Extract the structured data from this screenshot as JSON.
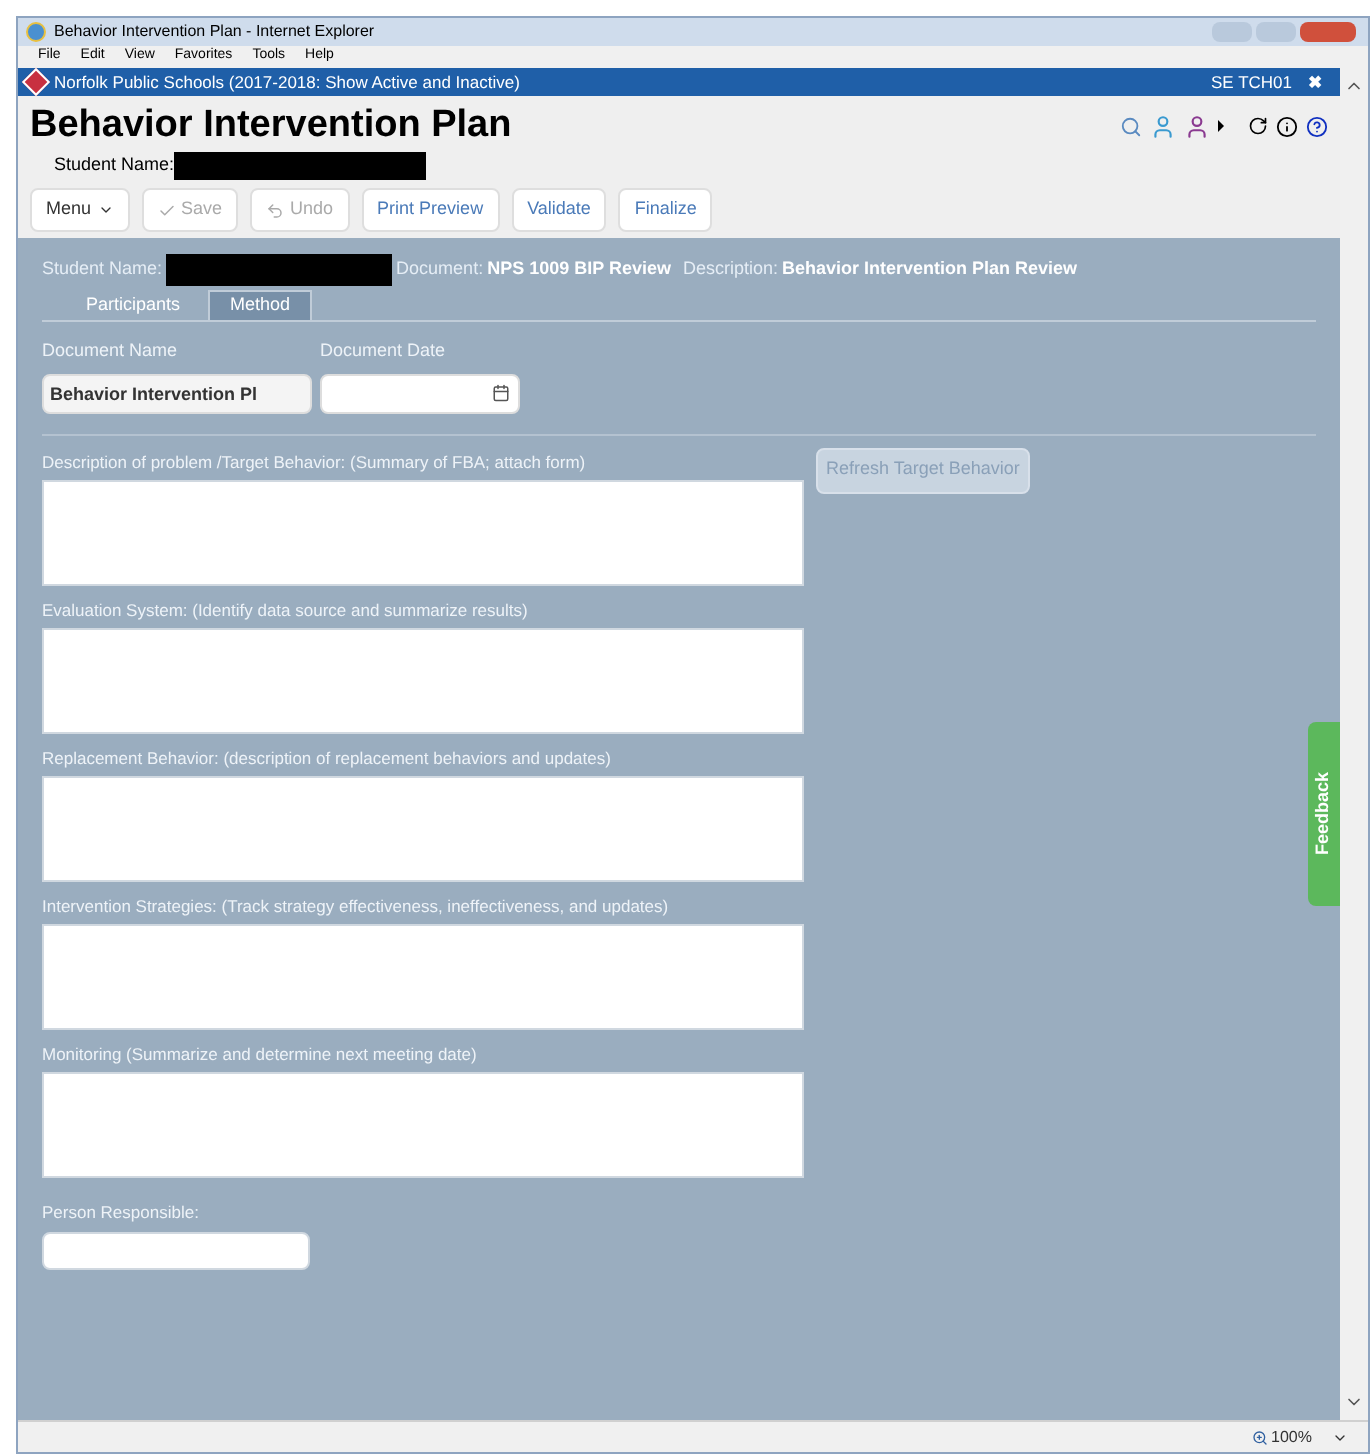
{
  "window": {
    "title": "Behavior Intervention Plan - Internet Explorer"
  },
  "menu_bar": [
    "File",
    "Edit",
    "View",
    "Favorites",
    "Tools",
    "Help"
  ],
  "app_bar": {
    "title": "Norfolk Public Schools (2017-2018: Show Active and Inactive)",
    "user": "SE TCH01",
    "close": "✖"
  },
  "page": {
    "title": "Behavior Intervention Plan",
    "student_label": "Student Name:"
  },
  "toolbar": [
    {
      "kind": "menu",
      "label": "Menu",
      "disabled": false
    },
    {
      "kind": "save",
      "label": "Save",
      "disabled": true
    },
    {
      "kind": "undo",
      "label": "Undo",
      "disabled": true
    },
    {
      "kind": "plain",
      "label": "Print Preview",
      "disabled": false
    },
    {
      "kind": "plain",
      "label": "Validate",
      "disabled": false
    },
    {
      "kind": "plain",
      "label": "Finalize",
      "disabled": false
    }
  ],
  "info": {
    "student_label": "Student Name:",
    "document_label": "Document:",
    "document": "NPS 1009 BIP Review",
    "description_label": "Description:",
    "description": "Behavior Intervention Plan Review"
  },
  "tabs": [
    {
      "label": "Participants",
      "selected": false
    },
    {
      "label": "Method",
      "selected": true
    }
  ],
  "document_fields": {
    "name_label": "Document Name",
    "name_value": "Behavior Intervention Pl",
    "date_label": "Document Date"
  },
  "refresh_button": "Refresh Target Behavior",
  "sections": [
    {
      "label": "Description of problem /Target Behavior: (Summary of FBA; attach form)"
    },
    {
      "label": "Evaluation System: (Identify data source and summarize results)"
    },
    {
      "label": "Replacement Behavior: (description of replacement behaviors and updates)"
    },
    {
      "label": "Intervention Strategies: (Track strategy effectiveness, ineffectiveness, and updates)"
    },
    {
      "label": "Monitoring (Summarize and determine next meeting date)"
    }
  ],
  "person_responsible": {
    "label": "Person Responsible:"
  },
  "feedback": "Feedback",
  "status_bar": {
    "zoom": "100%"
  }
}
